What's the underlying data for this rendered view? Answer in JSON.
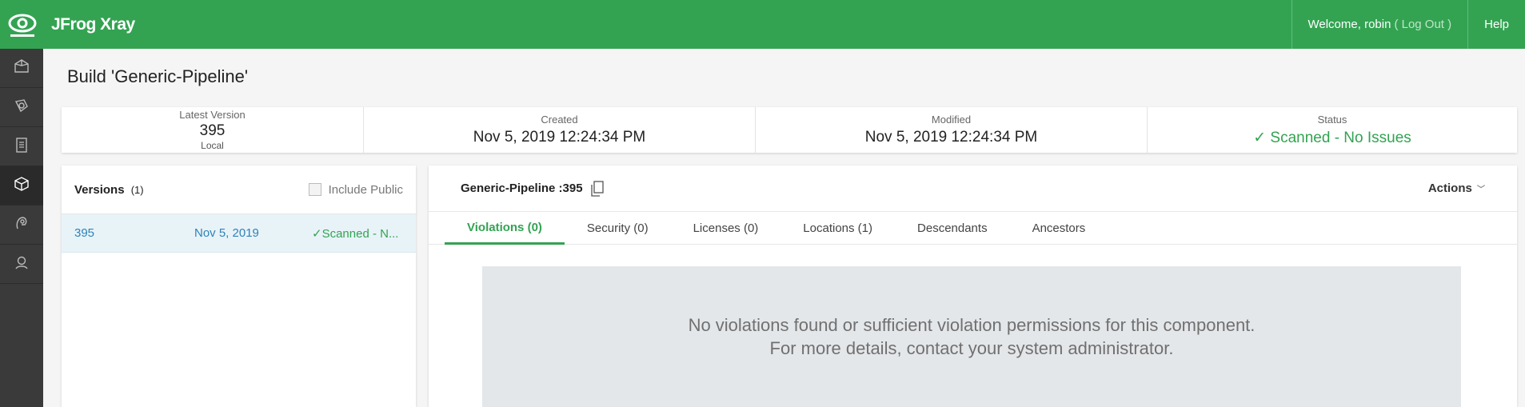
{
  "app": {
    "brand": "JFrog Xray"
  },
  "header": {
    "welcome": "Welcome, robin",
    "logout": "( Log Out )",
    "help": "Help"
  },
  "sidebar": {
    "items": [
      {
        "icon": "home-icon"
      },
      {
        "icon": "scan-icon"
      },
      {
        "icon": "reports-icon"
      },
      {
        "icon": "component-icon",
        "active": true
      },
      {
        "icon": "watch-icon"
      },
      {
        "icon": "admin-icon"
      }
    ]
  },
  "page": {
    "title": "Build 'Generic-Pipeline'"
  },
  "summary": {
    "latest_label": "Latest Version",
    "latest_value": "395",
    "latest_sub": "Local",
    "created_label": "Created",
    "created_value": "Nov 5, 2019 12:24:34 PM",
    "modified_label": "Modified",
    "modified_value": "Nov 5, 2019 12:24:34 PM",
    "status_label": "Status",
    "status_value": "✓ Scanned - No Issues"
  },
  "versions": {
    "title": "Versions",
    "count": "(1)",
    "include_public": "Include Public",
    "rows": [
      {
        "version": "395",
        "date": "Nov 5, 2019",
        "status": "✓Scanned - N..."
      }
    ]
  },
  "main": {
    "build_name": "Generic-Pipeline :395",
    "actions": "Actions",
    "tabs": [
      {
        "label": "Violations (0)",
        "active": true
      },
      {
        "label": "Security (0)"
      },
      {
        "label": "Licenses (0)"
      },
      {
        "label": "Locations (1)"
      },
      {
        "label": "Descendants"
      },
      {
        "label": "Ancestors"
      }
    ],
    "empty_line1": "No violations found or sufficient violation permissions for this component.",
    "empty_line2": "For more details, contact your system administrator."
  },
  "colors": {
    "brand_green": "#33a352",
    "sidebar": "#3a3a3a",
    "link_blue": "#2e82b8"
  }
}
